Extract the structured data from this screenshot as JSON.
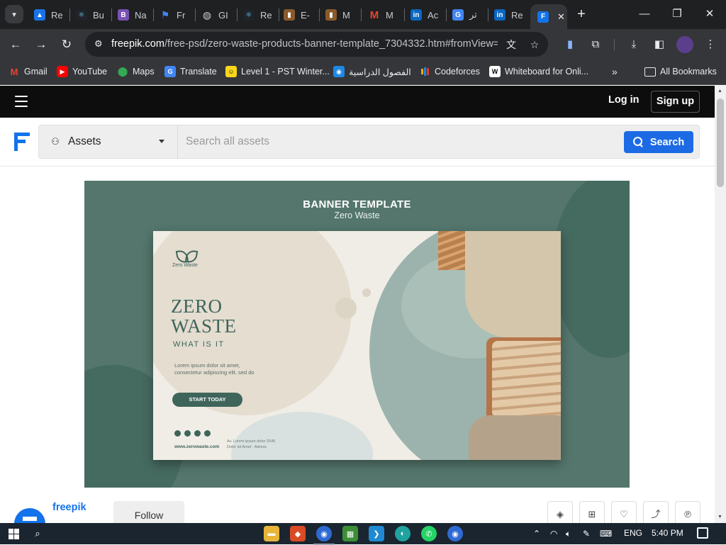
{
  "browser": {
    "tabs": [
      {
        "label": "Re",
        "icon": "google-drive-icon",
        "color": "#1a73e8"
      },
      {
        "label": "Bu",
        "icon": "react-icon",
        "color": "#61dafb"
      },
      {
        "label": "Na",
        "icon": "bootstrap-icon",
        "color": "#7952b3"
      },
      {
        "label": "Fr",
        "icon": "flag-icon",
        "color": "#4285f4"
      },
      {
        "label": "GI",
        "icon": "globe-icon",
        "color": "#9aa0a6"
      },
      {
        "label": "Re",
        "icon": "react-icon",
        "color": "#61dafb"
      },
      {
        "label": "E-",
        "icon": "book-icon",
        "color": "#8a5a2b"
      },
      {
        "label": "M",
        "icon": "book-icon",
        "color": "#8a5a2b"
      },
      {
        "label": "M",
        "icon": "gmail-icon",
        "color": "#ea4335"
      },
      {
        "label": "Ac",
        "icon": "linkedin-icon",
        "color": "#0a66c2"
      },
      {
        "label": "تر",
        "icon": "translate-icon",
        "color": "#4285f4"
      },
      {
        "label": "Re",
        "icon": "linkedin-icon",
        "color": "#0a66c2"
      }
    ],
    "active_tab_icon": "freepik-icon",
    "url_host": "freepik.com",
    "url_path": "/free-psd/zero-waste-products-banner-template_7304332.htm#fromView=...",
    "bookmarks": [
      {
        "label": "Gmail",
        "icon": "gmail-icon",
        "color": "#ea4335"
      },
      {
        "label": "YouTube",
        "icon": "youtube-icon",
        "color": "#ff0000"
      },
      {
        "label": "Maps",
        "icon": "maps-icon",
        "color": "#34a853"
      },
      {
        "label": "Translate",
        "icon": "translate-icon",
        "color": "#4285f4"
      },
      {
        "label": "Level 1 - PST Winter...",
        "icon": "smiley-icon",
        "color": "#f9d71c"
      },
      {
        "label": "الفصول الدراسية",
        "icon": "classroom-icon",
        "color": "#1e88e5"
      },
      {
        "label": "Codeforces",
        "icon": "codeforces-icon",
        "color": "#f2a900"
      },
      {
        "label": "Whiteboard for Onli...",
        "icon": "whiteboard-icon",
        "color": "#ffffff"
      }
    ],
    "all_bookmarks_label": "All Bookmarks"
  },
  "site": {
    "login_label": "Log in",
    "signup_label": "Sign up",
    "assets_label": "Assets",
    "search_placeholder": "Search all assets",
    "search_button_label": "Search",
    "author_name": "freepik",
    "follow_label": "Follow"
  },
  "preview": {
    "title": "BANNER TEMPLATE",
    "subtitle": "Zero Waste",
    "brand": "Zero Waste",
    "headline_line1": "ZERO",
    "headline_line2": "WASTE",
    "tagline": "WHAT IS IT",
    "body": "Lorem ipsum dolor sit amet, consectetur adipiscing elit, sed do",
    "cta": "START TODAY",
    "website": "www.zerowaste.com",
    "address_line1": "Av. Lorem ipsum dolor 2045",
    "address_line2": "Dolor sit Amet - Adress"
  },
  "taskbar": {
    "language": "ENG",
    "time": "5:40 PM"
  },
  "colors": {
    "browser_dark": "#1f2022",
    "toolbar": "#35363a",
    "freepik_blue": "#1273eb",
    "search_button": "#1d6ae5",
    "banner_green": "#54766c",
    "card_cream": "#f0ede6"
  }
}
